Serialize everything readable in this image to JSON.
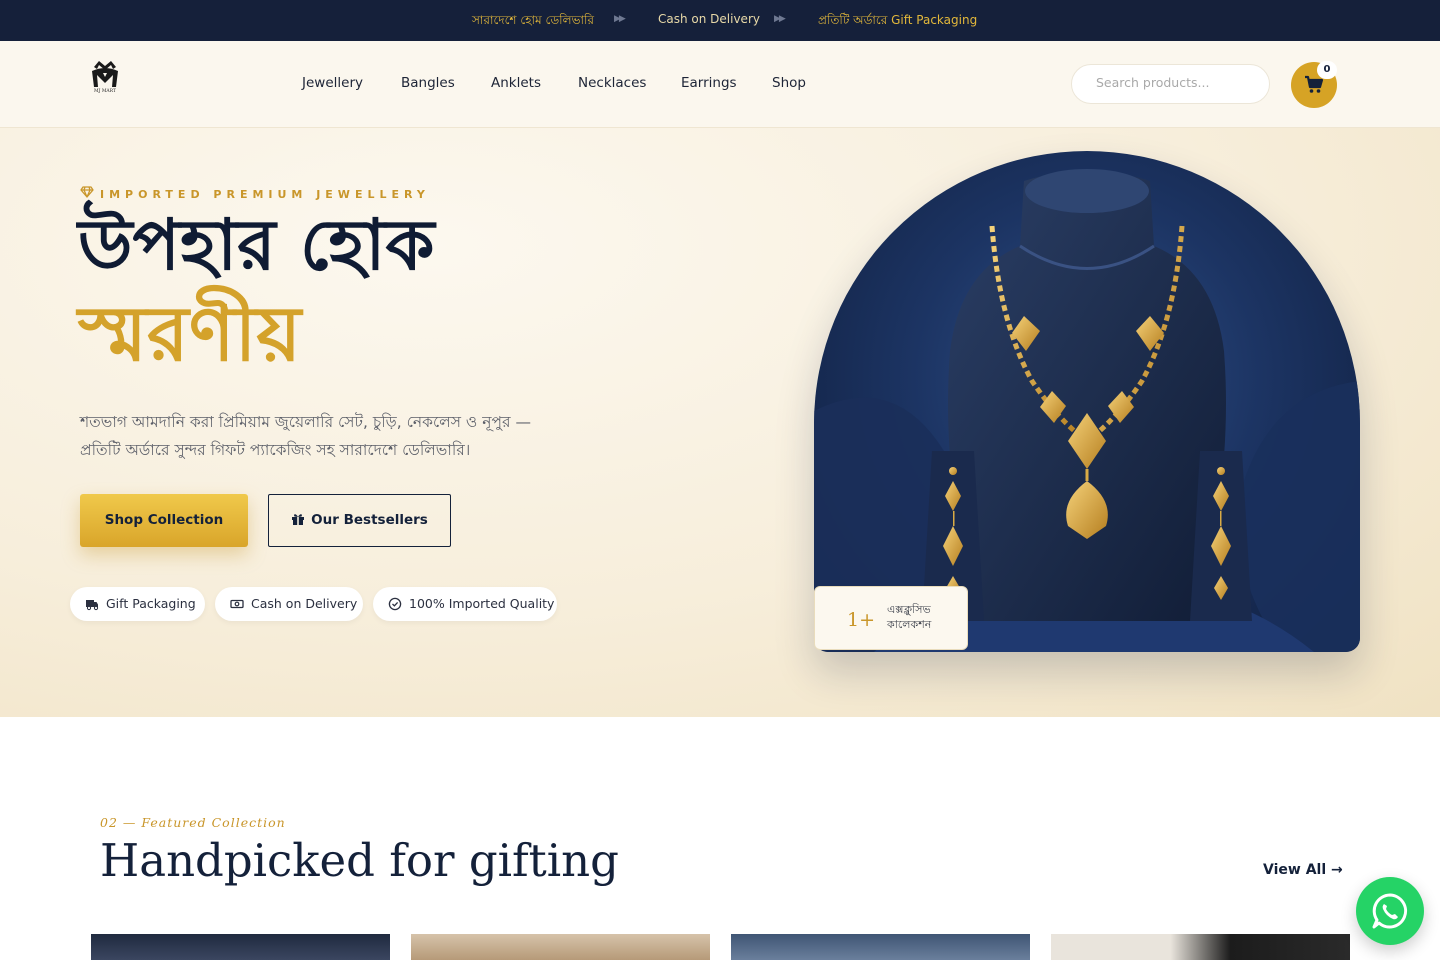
{
  "announcement": {
    "items": [
      "সারাদেশে হোম ডেলিভারি",
      "Cash on Delivery",
      "প্রতিটি অর্ডারে Gift Packaging"
    ]
  },
  "header": {
    "logo_text": "MJ MART",
    "nav": [
      "Jewellery",
      "Bangles",
      "Anklets",
      "Necklaces",
      "Earrings",
      "Shop"
    ],
    "search_placeholder": "Search products...",
    "cart_count": "0"
  },
  "hero": {
    "eyebrow": "IMPORTED PREMIUM JEWELLERY",
    "title_line1": "উপহার হোক",
    "title_line2": "স্মরণীয়",
    "description": "শতভাগ আমদানি করা প্রিমিয়াম জুয়েলারি সেট, চুড়ি, নেকলেস ও নূপুর — প্রতিটি অর্ডারে সুন্দর গিফট প্যাকেজিং সহ সারাদেশে ডেলিভারি।",
    "primary_button": "Shop Collection",
    "secondary_button": "Our Bestsellers",
    "features": [
      "Gift Packaging",
      "Cash on Delivery",
      "100% Imported Quality"
    ],
    "badge_number": "1+",
    "badge_line1": "এক্সক্লুসিভ",
    "badge_line2": "কালেকশন"
  },
  "featured": {
    "label": "02 — Featured Collection",
    "title": "Handpicked for gifting",
    "view_all": "View All →"
  },
  "colors": {
    "navy": "#15203a",
    "gold": "#d4a22b",
    "cream": "#fbf7ee",
    "whatsapp": "#25d366"
  }
}
